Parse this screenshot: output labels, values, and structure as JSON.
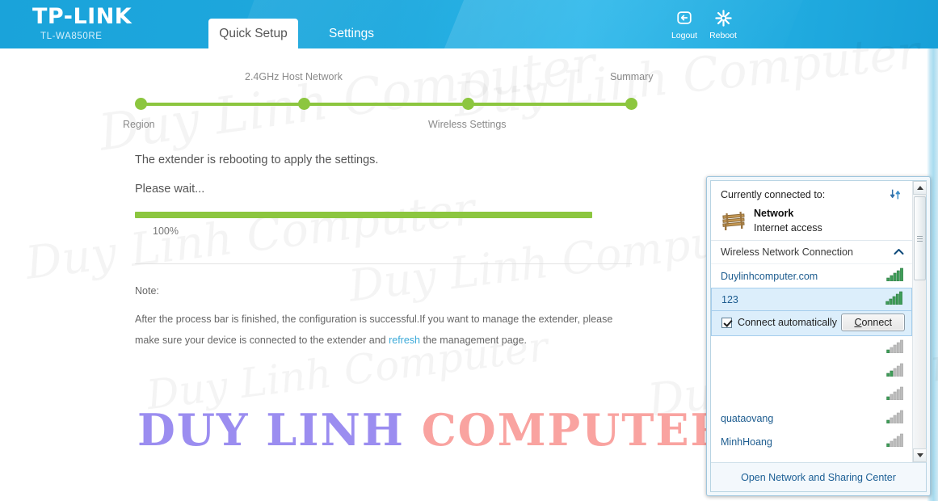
{
  "header": {
    "brand": "TP-LINK",
    "model": "TL-WA850RE",
    "tabs": [
      {
        "label": "Quick Setup",
        "active": true
      },
      {
        "label": "Settings",
        "active": false
      }
    ],
    "actions": [
      {
        "label": "Logout",
        "icon": "logout-icon"
      },
      {
        "label": "Reboot",
        "icon": "reboot-icon"
      }
    ],
    "accent_color": "#1fa9de"
  },
  "stepper": {
    "accent_color": "#8cc63f",
    "steps": [
      {
        "label": "Region",
        "position": "below"
      },
      {
        "label": "2.4GHz Host Network",
        "position": "above"
      },
      {
        "label": "Wireless Settings",
        "position": "below"
      },
      {
        "label": "Summary",
        "position": "above"
      }
    ]
  },
  "main": {
    "message_line1": "The extender is rebooting to apply the settings.",
    "message_line2": "Please wait...",
    "progress_percent": "100%",
    "progress_value": 100,
    "note_title": "Note:",
    "note_part1": "After the process bar is finished, the configuration is successful.If you want to manage the extender, please make sure your device is connected to the extender and ",
    "note_link": "refresh",
    "note_part2": " the management page."
  },
  "watermark": {
    "text_purple": "DUY LINH",
    "text_pink": "COMPUTER",
    "color_purple": "#9b8df0",
    "color_pink": "#f9a3a0",
    "faint": "Duy Linh Computer"
  },
  "network_flyout": {
    "currently_connected_label": "Currently connected to:",
    "refresh_icon": "refresh-icon",
    "current": {
      "name": "Network",
      "status": "Internet access",
      "icon": "bench-network-icon"
    },
    "section_label": "Wireless Network Connection",
    "section_chevron": "chevron-up-icon",
    "networks": [
      {
        "ssid": "Duylinhcomputer.com",
        "signal": 5,
        "selected": false
      },
      {
        "ssid": "123",
        "signal": 5,
        "selected": true
      },
      {
        "ssid": "",
        "signal": 1,
        "selected": false
      },
      {
        "ssid": "",
        "signal": 2,
        "selected": false
      },
      {
        "ssid": "",
        "signal": 1,
        "selected": false
      },
      {
        "ssid": "quataovang",
        "signal": 1,
        "selected": false
      },
      {
        "ssid": "MinhHoang",
        "signal": 1,
        "selected": false
      }
    ],
    "connect_automatically_label": "Connect automatically",
    "connect_automatically_checked": true,
    "connect_button_label": "Connect",
    "footer_link": "Open Network and Sharing Center"
  }
}
